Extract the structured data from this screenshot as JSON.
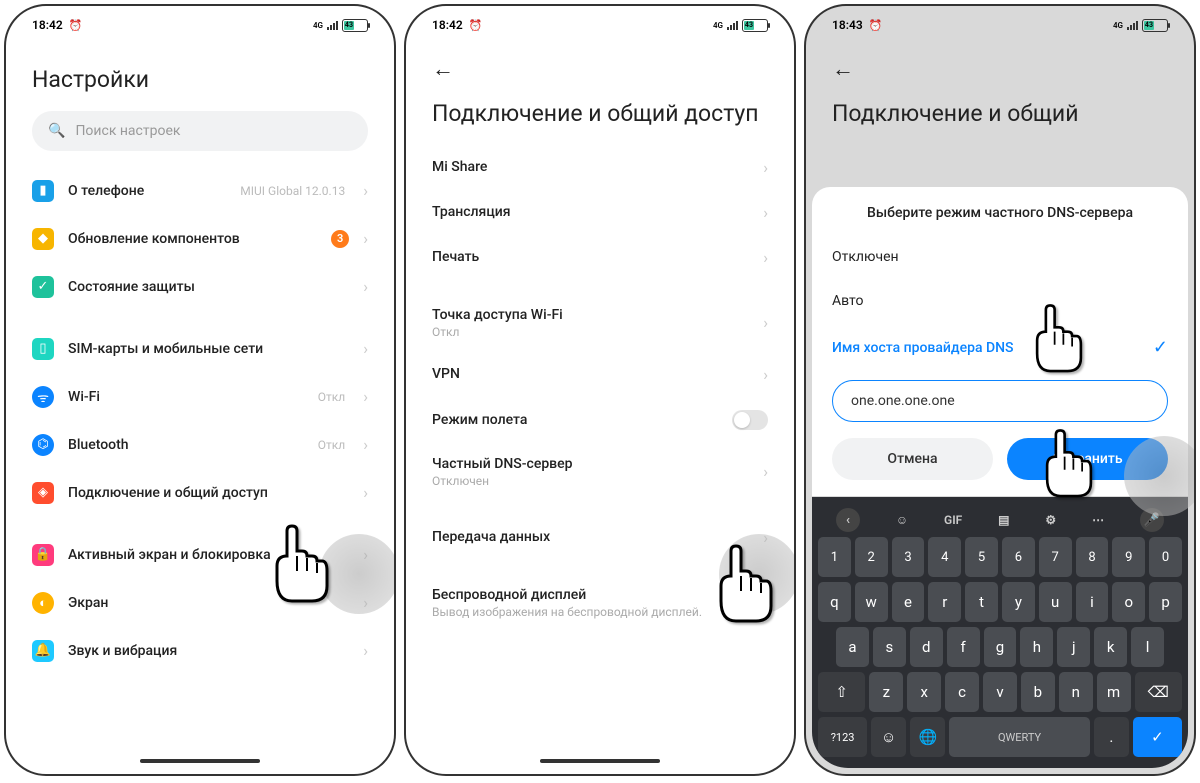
{
  "status": {
    "time1": "18:42",
    "time2": "18:42",
    "time3": "18:43",
    "batt": "43"
  },
  "p1": {
    "title": "Настройки",
    "search_placeholder": "Поиск настроек",
    "about": "О телефоне",
    "about_hint": "MIUI Global 12.0.13",
    "updates": "Обновление компонентов",
    "updates_badge": "3",
    "security": "Состояние защиты",
    "sim": "SIM-карты и мобильные сети",
    "wifi": "Wi-Fi",
    "wifi_hint": "Откл",
    "bt": "Bluetooth",
    "bt_hint": "Откл",
    "conn": "Подключение и общий доступ",
    "lock": "Активный экран и блокировка",
    "display": "Экран",
    "sound": "Звук и вибрация"
  },
  "p2": {
    "title": "Подключение и общий доступ",
    "mishare": "Mi Share",
    "cast": "Трансляция",
    "print": "Печать",
    "hotspot": "Точка доступа Wi-Fi",
    "hotspot_sub": "Откл",
    "vpn": "VPN",
    "airplane": "Режим полета",
    "dns": "Частный DNS-сервер",
    "dns_sub": "Отключен",
    "data": "Передача данных",
    "wdisplay": "Беспроводной дисплей",
    "wdisplay_sub": "Вывод изображения на беспроводной дисплей."
  },
  "p3": {
    "title": "Подключение и общий",
    "sheet_title": "Выберите режим частного DNS-сервера",
    "opt_off": "Отключен",
    "opt_auto": "Авто",
    "opt_host": "Имя хоста провайдера DNS",
    "input_value": "one.one.one.one",
    "cancel": "Отмена",
    "save": "Сохранить"
  },
  "kbd": {
    "gif": "GIF",
    "nums": [
      "1",
      "2",
      "3",
      "4",
      "5",
      "6",
      "7",
      "8",
      "9",
      "0"
    ],
    "r1": [
      "q",
      "w",
      "e",
      "r",
      "t",
      "y",
      "u",
      "i",
      "o",
      "p"
    ],
    "r2": [
      "a",
      "s",
      "d",
      "f",
      "g",
      "h",
      "j",
      "k",
      "l"
    ],
    "r3": [
      "z",
      "x",
      "c",
      "v",
      "b",
      "n",
      "m"
    ],
    "sym": "?123",
    "mode": "QWERTY"
  }
}
